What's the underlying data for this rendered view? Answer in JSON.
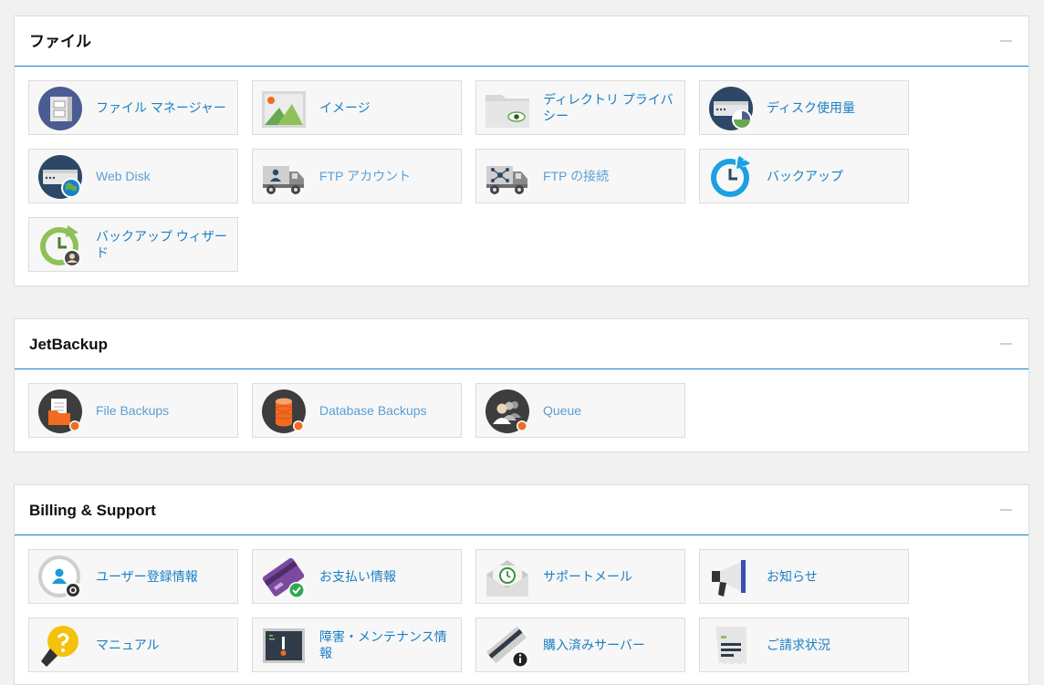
{
  "colors": {
    "accent": "#1b7fc3",
    "background": "#f1f1f1",
    "panel": "#ffffff"
  },
  "sections": {
    "files": {
      "title": "ファイル",
      "items": [
        {
          "label": "ファイル マネージャー",
          "icon": "file-manager-icon"
        },
        {
          "label": "イメージ",
          "icon": "images-icon"
        },
        {
          "label": "ディレクトリ プライバシー",
          "icon": "directory-privacy-icon"
        },
        {
          "label": "ディスク使用量",
          "icon": "disk-usage-icon"
        },
        {
          "label": "Web Disk",
          "icon": "web-disk-icon"
        },
        {
          "label": "FTP アカウント",
          "icon": "ftp-accounts-icon"
        },
        {
          "label": "FTP の接続",
          "icon": "ftp-connections-icon"
        },
        {
          "label": "バックアップ",
          "icon": "backup-icon"
        },
        {
          "label": "バックアップ ウィザード",
          "icon": "backup-wizard-icon"
        }
      ]
    },
    "jetbackup": {
      "title": "JetBackup",
      "items": [
        {
          "label": "File Backups",
          "icon": "file-backups-icon"
        },
        {
          "label": "Database Backups",
          "icon": "database-backups-icon"
        },
        {
          "label": "Queue",
          "icon": "queue-icon"
        }
      ]
    },
    "billing": {
      "title": "Billing & Support",
      "items": [
        {
          "label": "ユーザー登録情報",
          "icon": "user-info-icon"
        },
        {
          "label": "お支払い情報",
          "icon": "payment-info-icon"
        },
        {
          "label": "サポートメール",
          "icon": "support-mail-icon"
        },
        {
          "label": "お知らせ",
          "icon": "announcements-icon"
        },
        {
          "label": "マニュアル",
          "icon": "manual-icon"
        },
        {
          "label": "障害・メンテナンス情報",
          "icon": "maintenance-info-icon"
        },
        {
          "label": "購入済みサーバー",
          "icon": "purchased-servers-icon"
        },
        {
          "label": "ご請求状況",
          "icon": "billing-status-icon"
        }
      ]
    }
  }
}
